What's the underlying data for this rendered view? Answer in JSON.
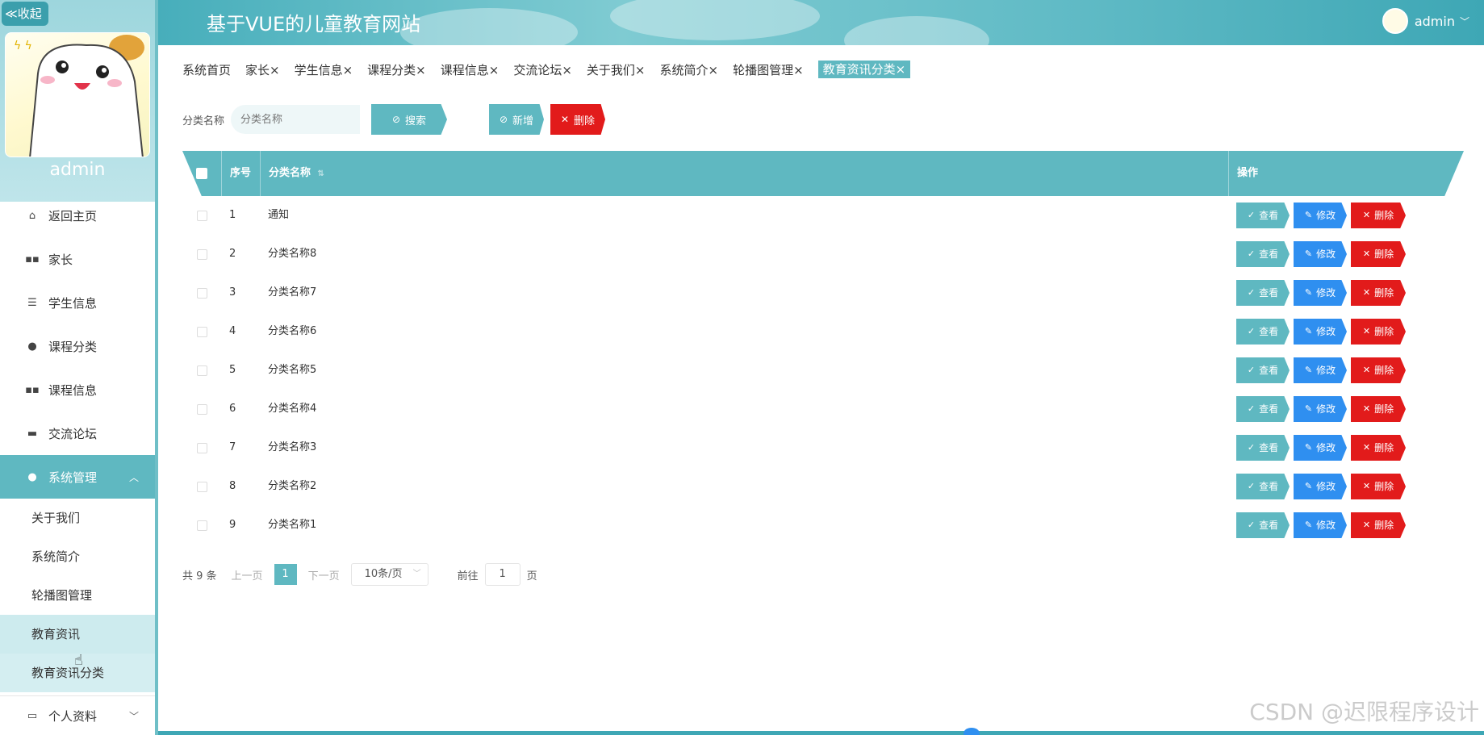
{
  "sidebar": {
    "collapse_label": "≪收起",
    "username": "admin",
    "items": [
      {
        "label": "返回主页",
        "icon": "home-icon"
      },
      {
        "label": "家长",
        "icon": "grid-icon"
      },
      {
        "label": "学生信息",
        "icon": "list-icon"
      },
      {
        "label": "课程分类",
        "icon": "user-icon"
      },
      {
        "label": "课程信息",
        "icon": "grid-icon"
      },
      {
        "label": "交流论坛",
        "icon": "forum-icon"
      },
      {
        "label": "系统管理",
        "icon": "bulb-icon"
      }
    ],
    "sub_items": [
      {
        "label": "关于我们"
      },
      {
        "label": "系统简介"
      },
      {
        "label": "轮播图管理"
      },
      {
        "label": "教育资讯"
      },
      {
        "label": "教育资讯分类"
      }
    ],
    "bottom_item": {
      "label": "个人资料"
    }
  },
  "header": {
    "title": "基于VUE的儿童教育网站",
    "user": "admin"
  },
  "tabs": [
    {
      "label": "系统首页"
    },
    {
      "label": "家长×"
    },
    {
      "label": "学生信息×"
    },
    {
      "label": "课程分类×"
    },
    {
      "label": "课程信息×"
    },
    {
      "label": "交流论坛×"
    },
    {
      "label": "关于我们×"
    },
    {
      "label": "系统简介×"
    },
    {
      "label": "轮播图管理×"
    },
    {
      "label": "教育资讯分类×"
    }
  ],
  "search": {
    "label": "分类名称",
    "placeholder": "分类名称",
    "search_button": "搜索",
    "add_button": "新增",
    "delete_button": "删除"
  },
  "table": {
    "headers": {
      "index": "序号",
      "name": "分类名称",
      "ops": "操作"
    },
    "rows": [
      {
        "index": "1",
        "name": "通知"
      },
      {
        "index": "2",
        "name": "分类名称8"
      },
      {
        "index": "3",
        "name": "分类名称7"
      },
      {
        "index": "4",
        "name": "分类名称6"
      },
      {
        "index": "5",
        "name": "分类名称5"
      },
      {
        "index": "6",
        "name": "分类名称4"
      },
      {
        "index": "7",
        "name": "分类名称3"
      },
      {
        "index": "8",
        "name": "分类名称2"
      },
      {
        "index": "9",
        "name": "分类名称1"
      }
    ],
    "op_labels": {
      "view": "查看",
      "edit": "修改",
      "delete": "删除"
    }
  },
  "pager": {
    "total": "共 9 条",
    "prev": "上一页",
    "current": "1",
    "next": "下一页",
    "page_size": "10条/页",
    "goto_label": "前往",
    "goto_value": "1",
    "page_unit": "页"
  },
  "watermark": "CSDN @迟限程序设计",
  "colors": {
    "accent": "#5fb8c1",
    "edit": "#2f8ff0",
    "danger": "#e21b1b"
  }
}
